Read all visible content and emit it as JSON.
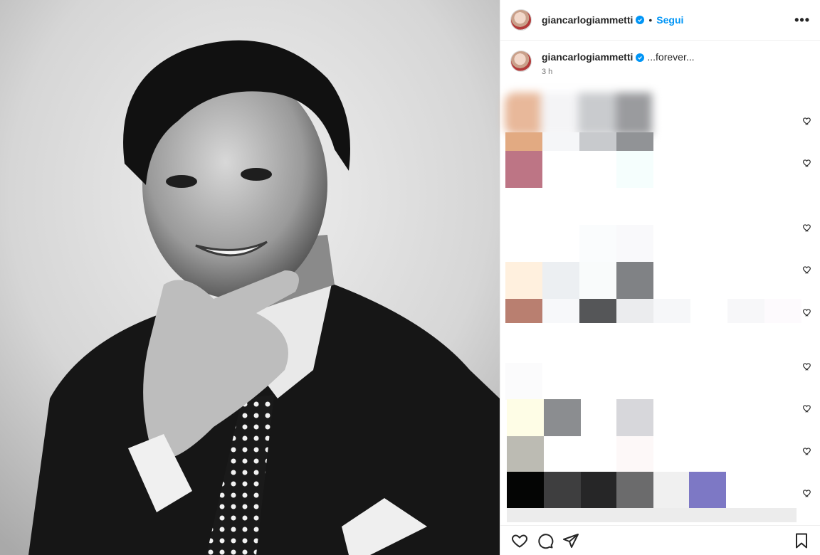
{
  "post": {
    "author": "giancarlogiammetti",
    "follow_label": "Segui",
    "separator": "•",
    "more_label": "•••",
    "caption": "...forever...",
    "time_ago": "3 h"
  },
  "colors": {
    "accent": "#0095f6",
    "text": "#262626",
    "muted": "#737373",
    "divider": "#efefef"
  },
  "icons": {
    "like": "heart-icon",
    "comment": "comment-icon",
    "share": "share-icon",
    "save": "bookmark-icon",
    "more": "more-options-icon",
    "verified": "verified-badge-icon"
  }
}
